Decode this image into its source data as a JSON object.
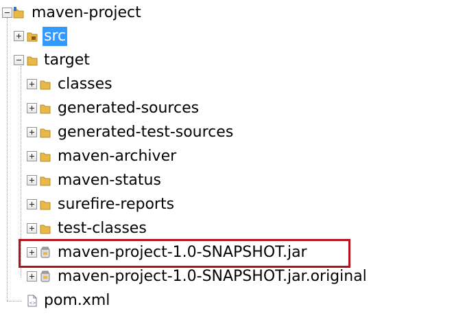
{
  "tree": {
    "root": {
      "label": "maven-project",
      "icon": "project-folder-icon",
      "expanded": true
    },
    "nodes": [
      {
        "label": "src",
        "icon": "source-folder-icon",
        "expanded": false,
        "selected": true
      },
      {
        "label": "target",
        "icon": "folder-icon",
        "expanded": true,
        "selected": false
      }
    ],
    "target_children": [
      {
        "label": "classes",
        "icon": "folder-icon"
      },
      {
        "label": "generated-sources",
        "icon": "folder-icon"
      },
      {
        "label": "generated-test-sources",
        "icon": "folder-icon"
      },
      {
        "label": "maven-archiver",
        "icon": "folder-icon"
      },
      {
        "label": "maven-status",
        "icon": "folder-icon"
      },
      {
        "label": "surefire-reports",
        "icon": "folder-icon"
      },
      {
        "label": "test-classes",
        "icon": "folder-icon"
      },
      {
        "label": "maven-project-1.0-SNAPSHOT.jar",
        "icon": "jar-archive-icon",
        "highlighted": true
      },
      {
        "label": "maven-project-1.0-SNAPSHOT.jar.original",
        "icon": "jar-archive-icon"
      }
    ],
    "files": [
      {
        "label": "pom.xml",
        "icon": "xml-file-icon"
      }
    ]
  },
  "colors": {
    "selection": "#3399ff",
    "highlight_border": "#b3111a",
    "folder": "#e8b84a"
  }
}
